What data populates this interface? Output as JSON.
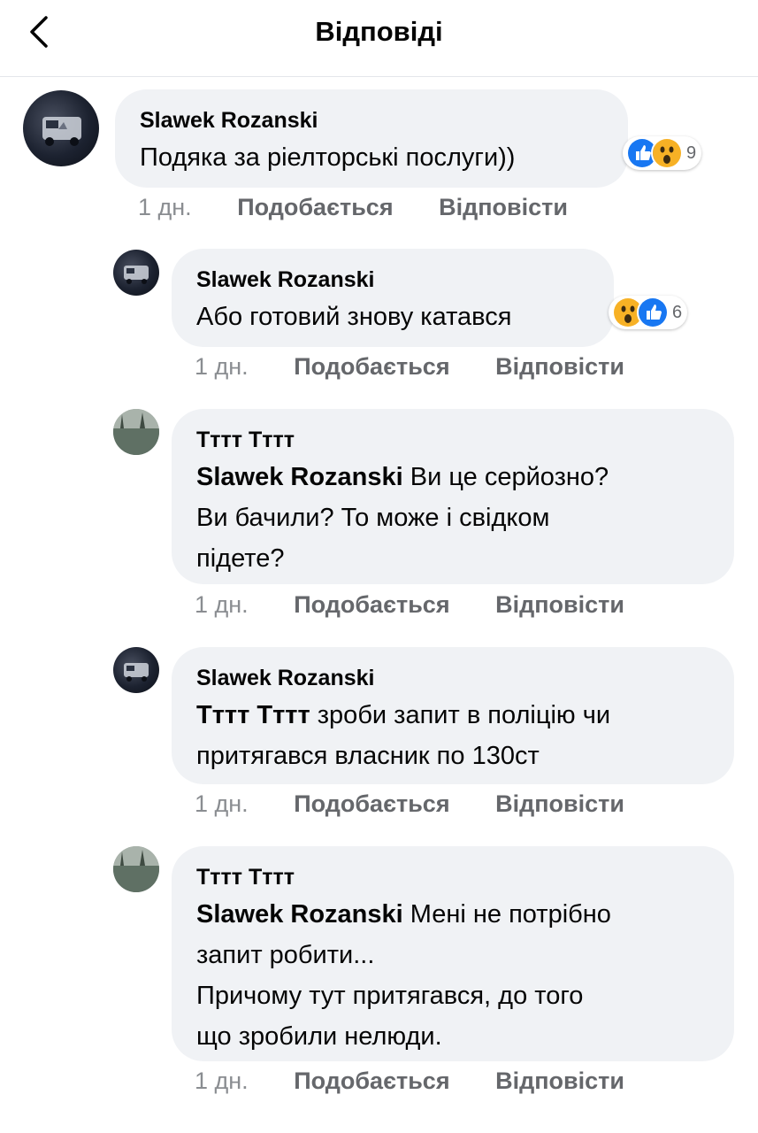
{
  "header": {
    "title": "Відповіді"
  },
  "comments": [
    {
      "author": "Slawek Rozanski",
      "lines": [
        "Подяка за ріелторські послуги))"
      ],
      "time": "1 дн.",
      "like": "Подобається",
      "reply": "Відповісти",
      "reactions": {
        "icons": [
          "like",
          "wow"
        ],
        "count": "9"
      }
    },
    {
      "author": "Slawek Rozanski",
      "lines": [
        "Або готовий знову катався"
      ],
      "time": "1 дн.",
      "like": "Подобається",
      "reply": "Відповісти",
      "reactions": {
        "icons": [
          "wow",
          "like"
        ],
        "count": "6"
      }
    },
    {
      "author": "Тттт Тттт",
      "mention": "Slawek Rozanski",
      "line1_rest": " Ви це серйозно?",
      "lines": [
        "Ви бачили? То може і свідком",
        "підете?"
      ],
      "time": "1 дн.",
      "like": "Подобається",
      "reply": "Відповісти"
    },
    {
      "author": "Slawek Rozanski",
      "mention": "Тттт Тттт",
      "line1_rest": " зроби запит в поліцію чи",
      "lines": [
        "притягався власник по 130ст"
      ],
      "time": "1 дн.",
      "like": "Подобається",
      "reply": "Відповісти"
    },
    {
      "author": "Тттт Тттт",
      "mention": "Slawek Rozanski",
      "line1_rest": " Мені не потрібно",
      "lines": [
        "запит робити...",
        "Причому тут притягався, до того",
        "що зробили нелюди."
      ],
      "time": "1 дн.",
      "like": "Подобається",
      "reply": "Відповісти"
    }
  ],
  "colors": {
    "like_blue": "#1877f2",
    "wow_yellow": "#f7b125",
    "bubble": "#f0f2f5",
    "meta": "#65676b"
  }
}
